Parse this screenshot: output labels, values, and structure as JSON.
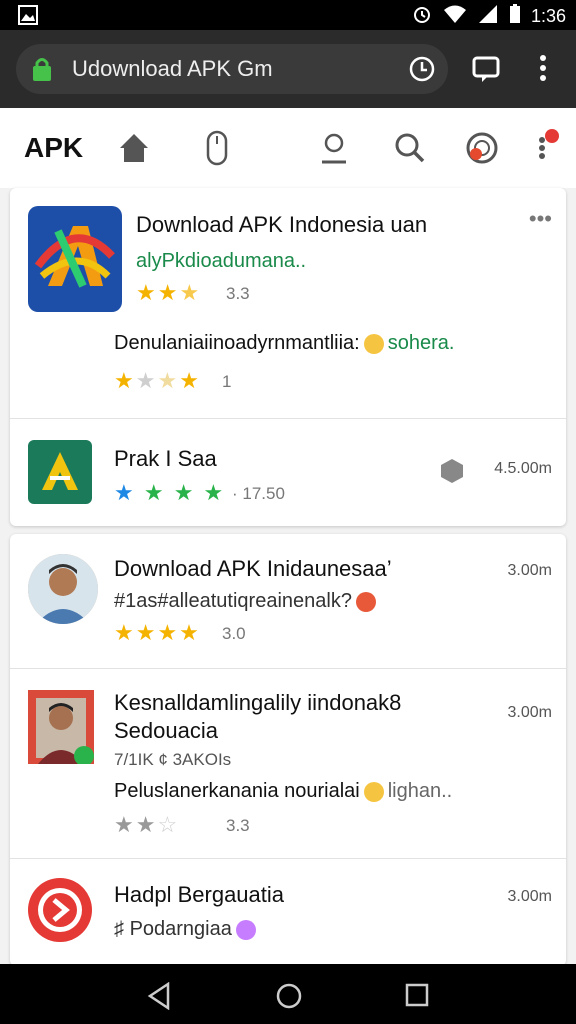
{
  "status_bar": {
    "time": "1:36"
  },
  "browser": {
    "url": "Udownload APK Gm"
  },
  "header": {
    "logo": "APK"
  },
  "cards": [
    {
      "title": "Download APK Indonesia uan",
      "subtitle": "alyPkdioadumana..",
      "rating": "3.3",
      "description": "Denulaniaiinoadyrnmantliia:",
      "description_tail": "sohera.",
      "rating2": "1"
    },
    {
      "title": "Prak I Saa",
      "rating": "· 17.50",
      "size": "4.5.00m"
    },
    {
      "title": "Download APK Inidaunesaa’",
      "subtitle": "#1as#alleatutiqreainenalk?",
      "rating": "3.0",
      "size": "3.00m"
    },
    {
      "title": "Kesnalldamlingalily iindonak8",
      "title2": "Sedouacia",
      "meta": "7/1IK ¢ 3AKOIs",
      "description": "Peluslanerkanania nourialai",
      "description_tail": "lighan..",
      "rating": "3.3",
      "size": "3.00m"
    },
    {
      "title": "Hadpl Bergauatia",
      "subtitle": "Podarngiaa",
      "size": "3.00m"
    }
  ],
  "colors": {
    "accent_green": "#1a8a4a",
    "star_yellow": "#f5b301",
    "toolbar": "#2b2b2b"
  }
}
